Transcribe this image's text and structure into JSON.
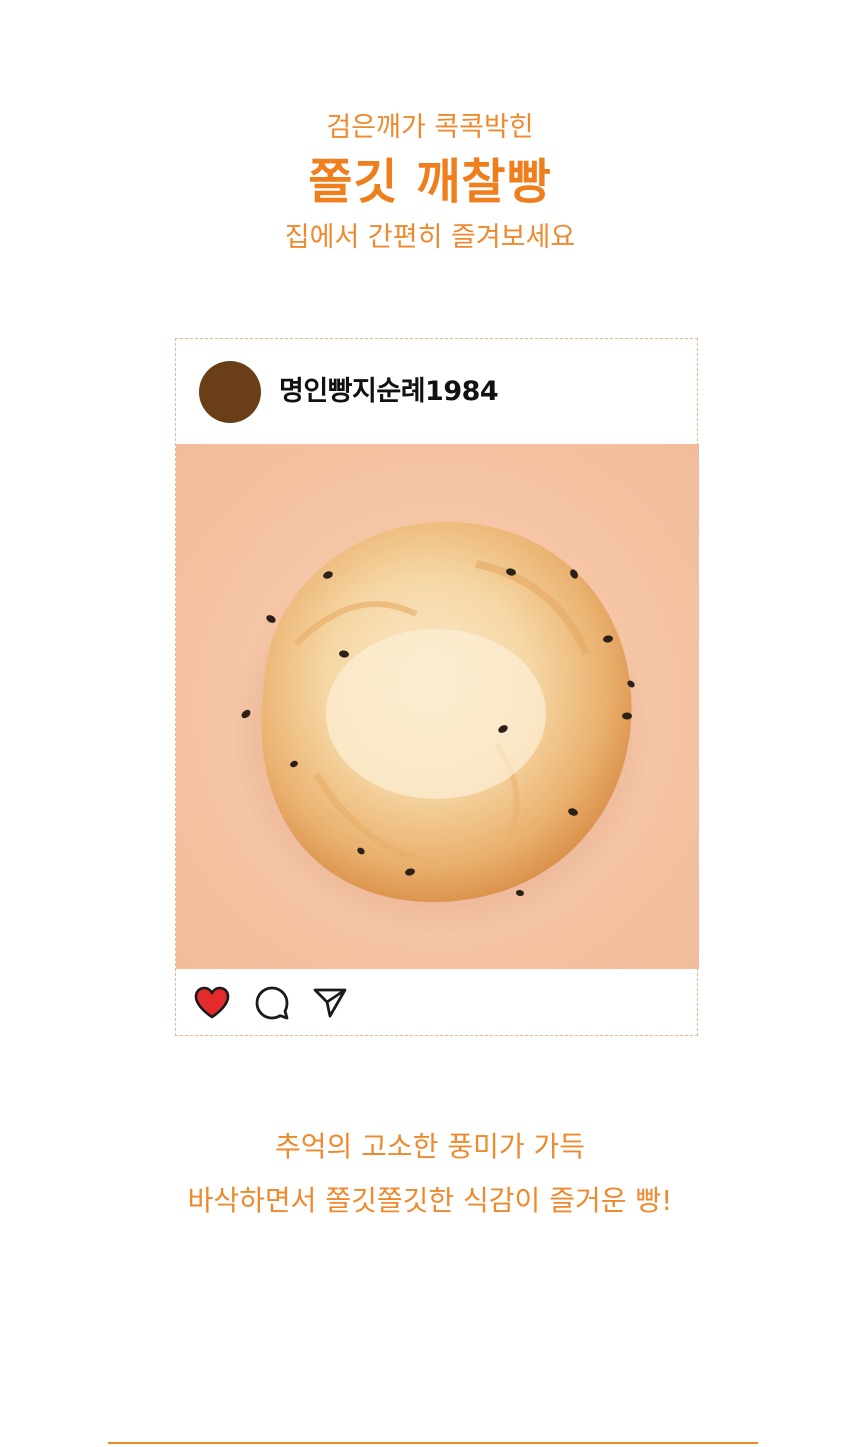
{
  "intro": {
    "line1": "검은깨가 콕콕박힌",
    "title": "쫄깃 깨찰빵",
    "line3": "집에서 간편히 즐겨보세요"
  },
  "post": {
    "username": "명인빵지순례1984",
    "avatar_color": "#6a3f18",
    "photo_description_icon": "sesame-bread-photo",
    "actions": [
      {
        "icon": "heart-icon",
        "liked": true,
        "color": "#e32b2b"
      },
      {
        "icon": "comment-icon"
      },
      {
        "icon": "send-icon"
      }
    ]
  },
  "outro": {
    "line1": "추억의 고소한 풍미가 가득",
    "line2": "바삭하면서 쫄깃쫄깃한 식감이 즐거운 빵!"
  },
  "colors": {
    "accent": "#ee8a2d",
    "photo_background": "#f6c6a8",
    "border": "#e9b58a"
  }
}
